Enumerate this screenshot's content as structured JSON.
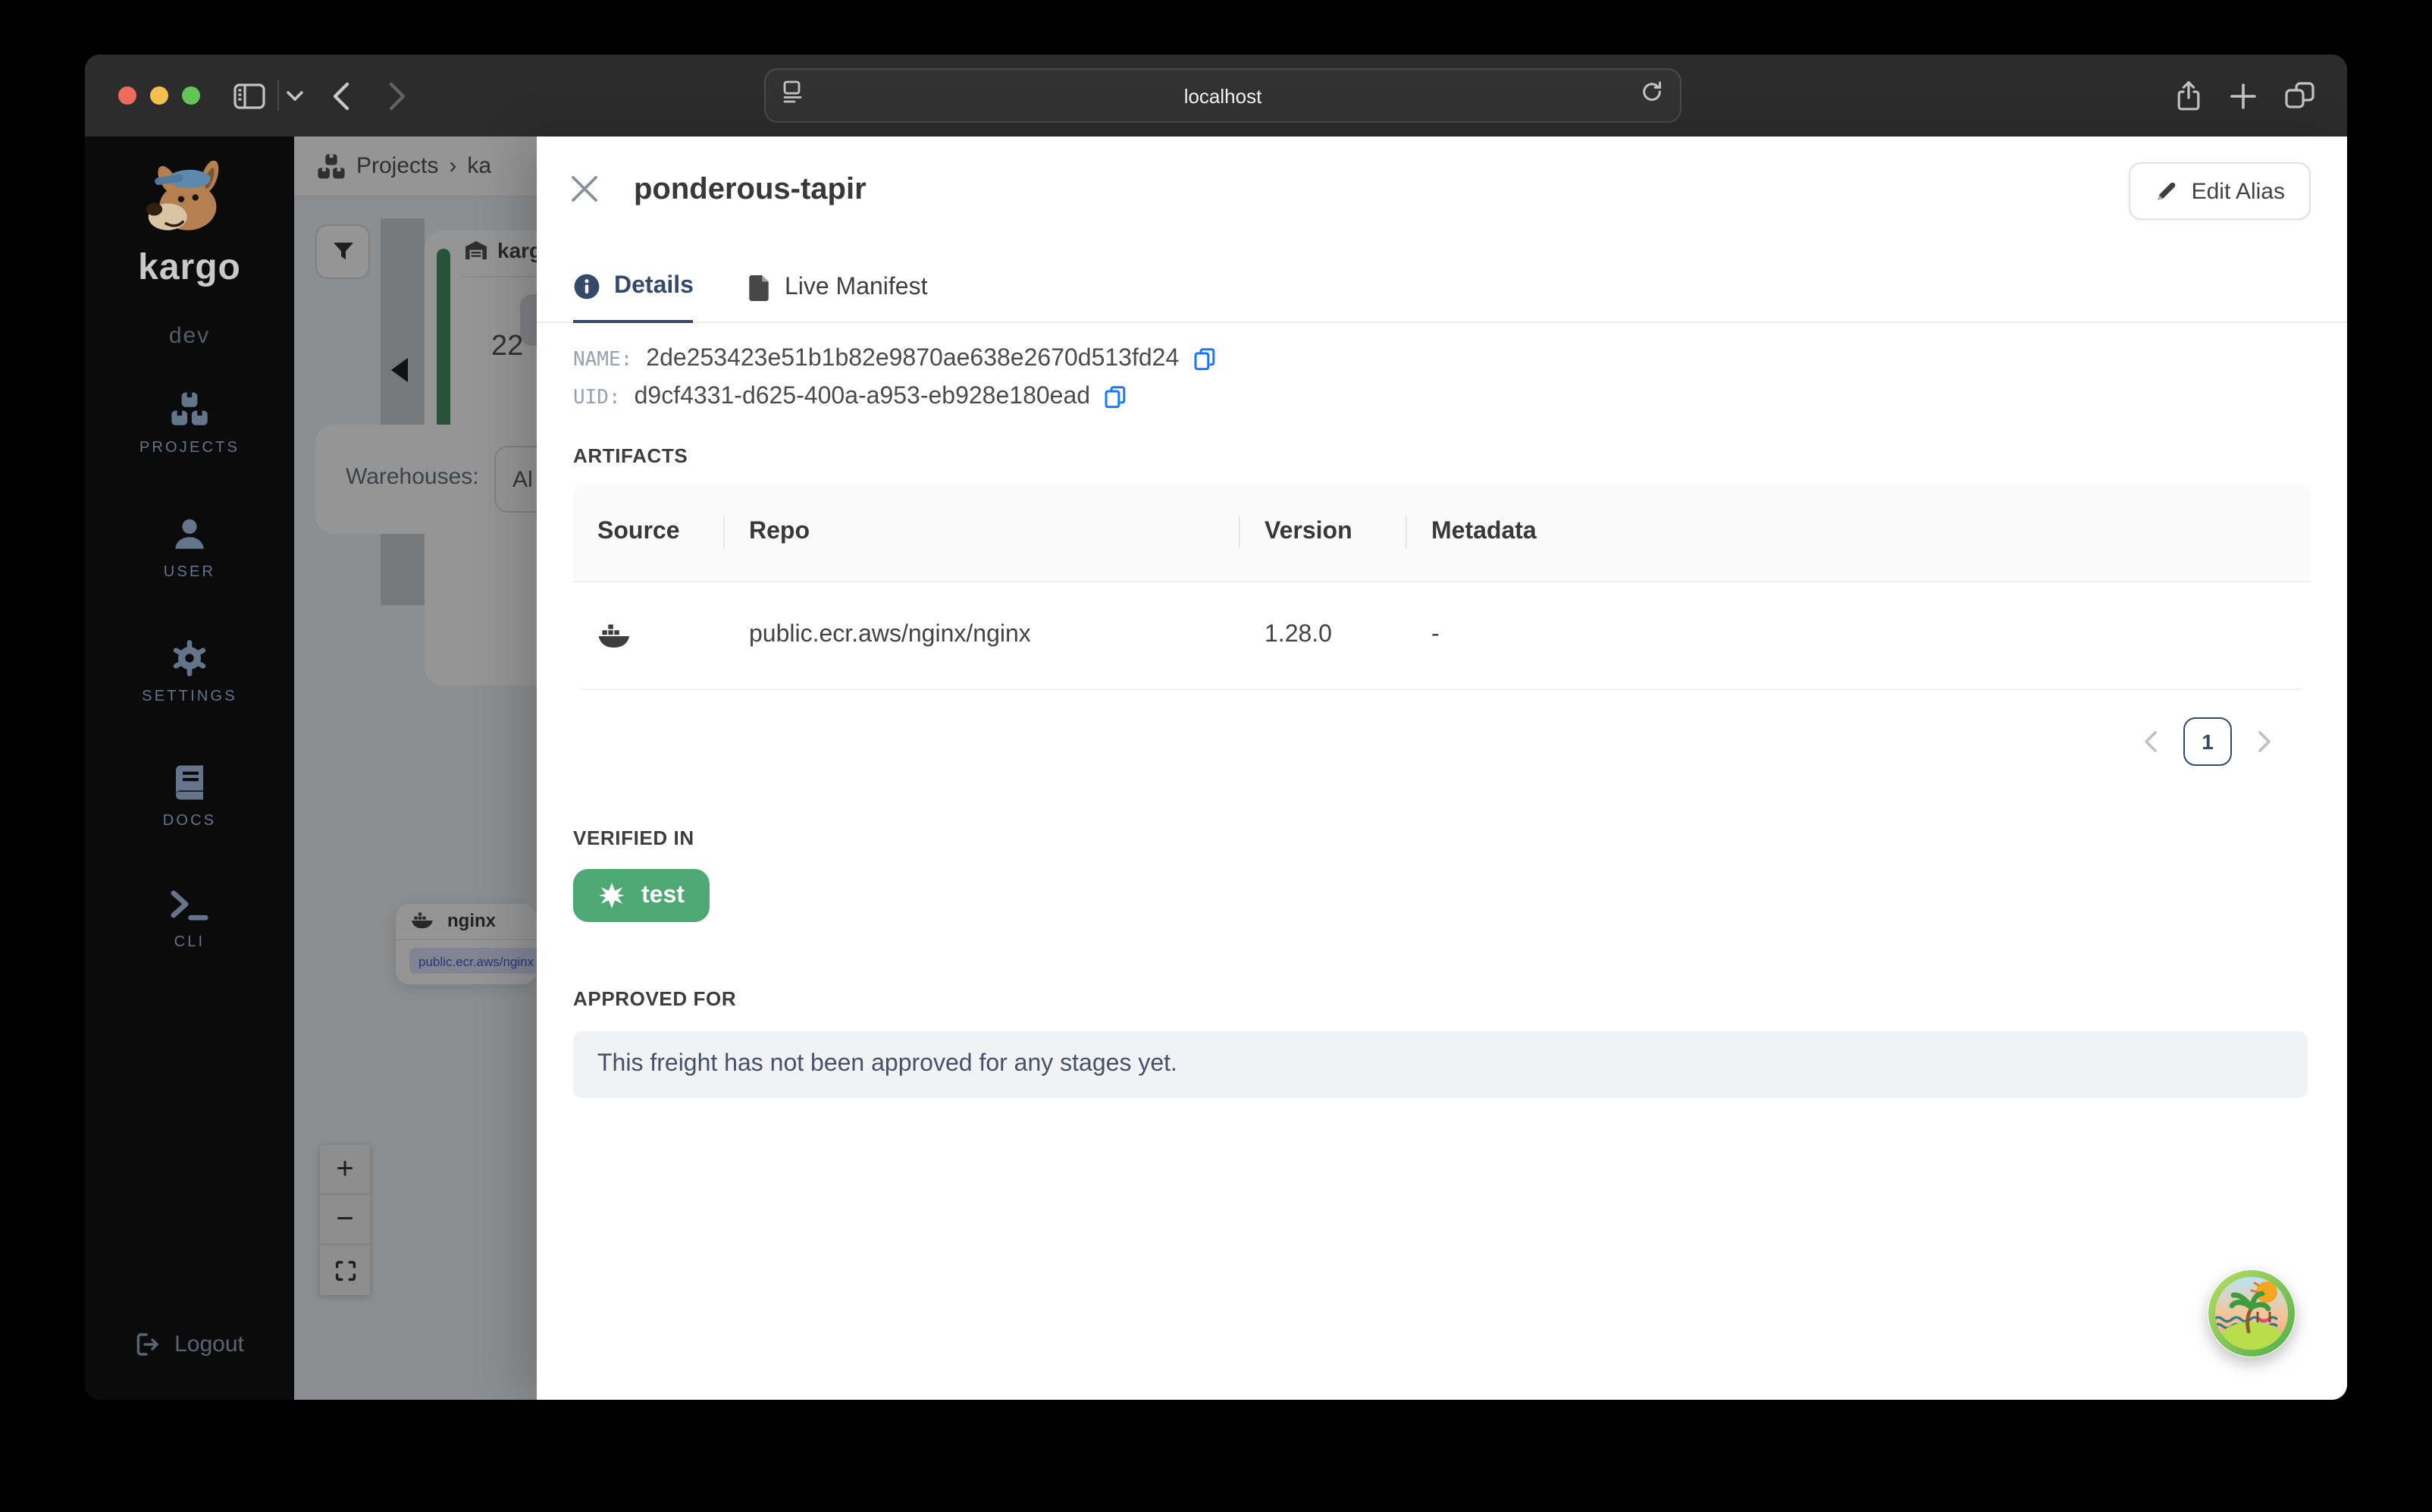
{
  "browser": {
    "url": "localhost"
  },
  "sidebar": {
    "brand": "kargo",
    "env": "dev",
    "items": [
      {
        "label": "PROJECTS"
      },
      {
        "label": "USER"
      },
      {
        "label": "SETTINGS"
      },
      {
        "label": "DOCS"
      },
      {
        "label": "CLI"
      }
    ],
    "logout_label": "Logout"
  },
  "page": {
    "breadcrumb": {
      "root": "Projects",
      "separator": "›",
      "current": "ka"
    },
    "stage_card": {
      "name": "karg",
      "count": "22"
    },
    "warehouses": {
      "label": "Warehouses:",
      "selected": "Al"
    },
    "node": {
      "name": "nginx",
      "repo": "public.ecr.aws/nginx"
    },
    "zoom_controls": {
      "zoom_in": "+",
      "zoom_out": "−"
    }
  },
  "drawer": {
    "title": "ponderous-tapir",
    "edit_alias_label": "Edit Alias",
    "tabs": [
      {
        "label": "Details"
      },
      {
        "label": "Live Manifest"
      }
    ],
    "fields": {
      "name_label": "NAME:",
      "name_value": "2de253423e51b1b82e9870ae638e2670d513fd24",
      "uid_label": "UID:",
      "uid_value": "d9cf4331-d625-400a-a953-eb928e180ead"
    },
    "artifacts": {
      "heading": "ARTIFACTS",
      "columns": [
        "Source",
        "Repo",
        "Version",
        "Metadata"
      ],
      "rows": [
        {
          "repo": "public.ecr.aws/nginx/nginx",
          "version": "1.28.0",
          "metadata": "-"
        }
      ],
      "pagination": {
        "current": "1"
      }
    },
    "verified_in": {
      "heading": "VERIFIED IN",
      "stages": [
        {
          "label": "test",
          "color": "#4ea873"
        }
      ]
    },
    "approved_for": {
      "heading": "APPROVED FOR",
      "empty_message": "This freight has not been approved for any stages yet."
    }
  },
  "colors": {
    "accent_navy": "#35496b",
    "copy_blue": "#1677ff",
    "verified_green": "#4ea873"
  }
}
